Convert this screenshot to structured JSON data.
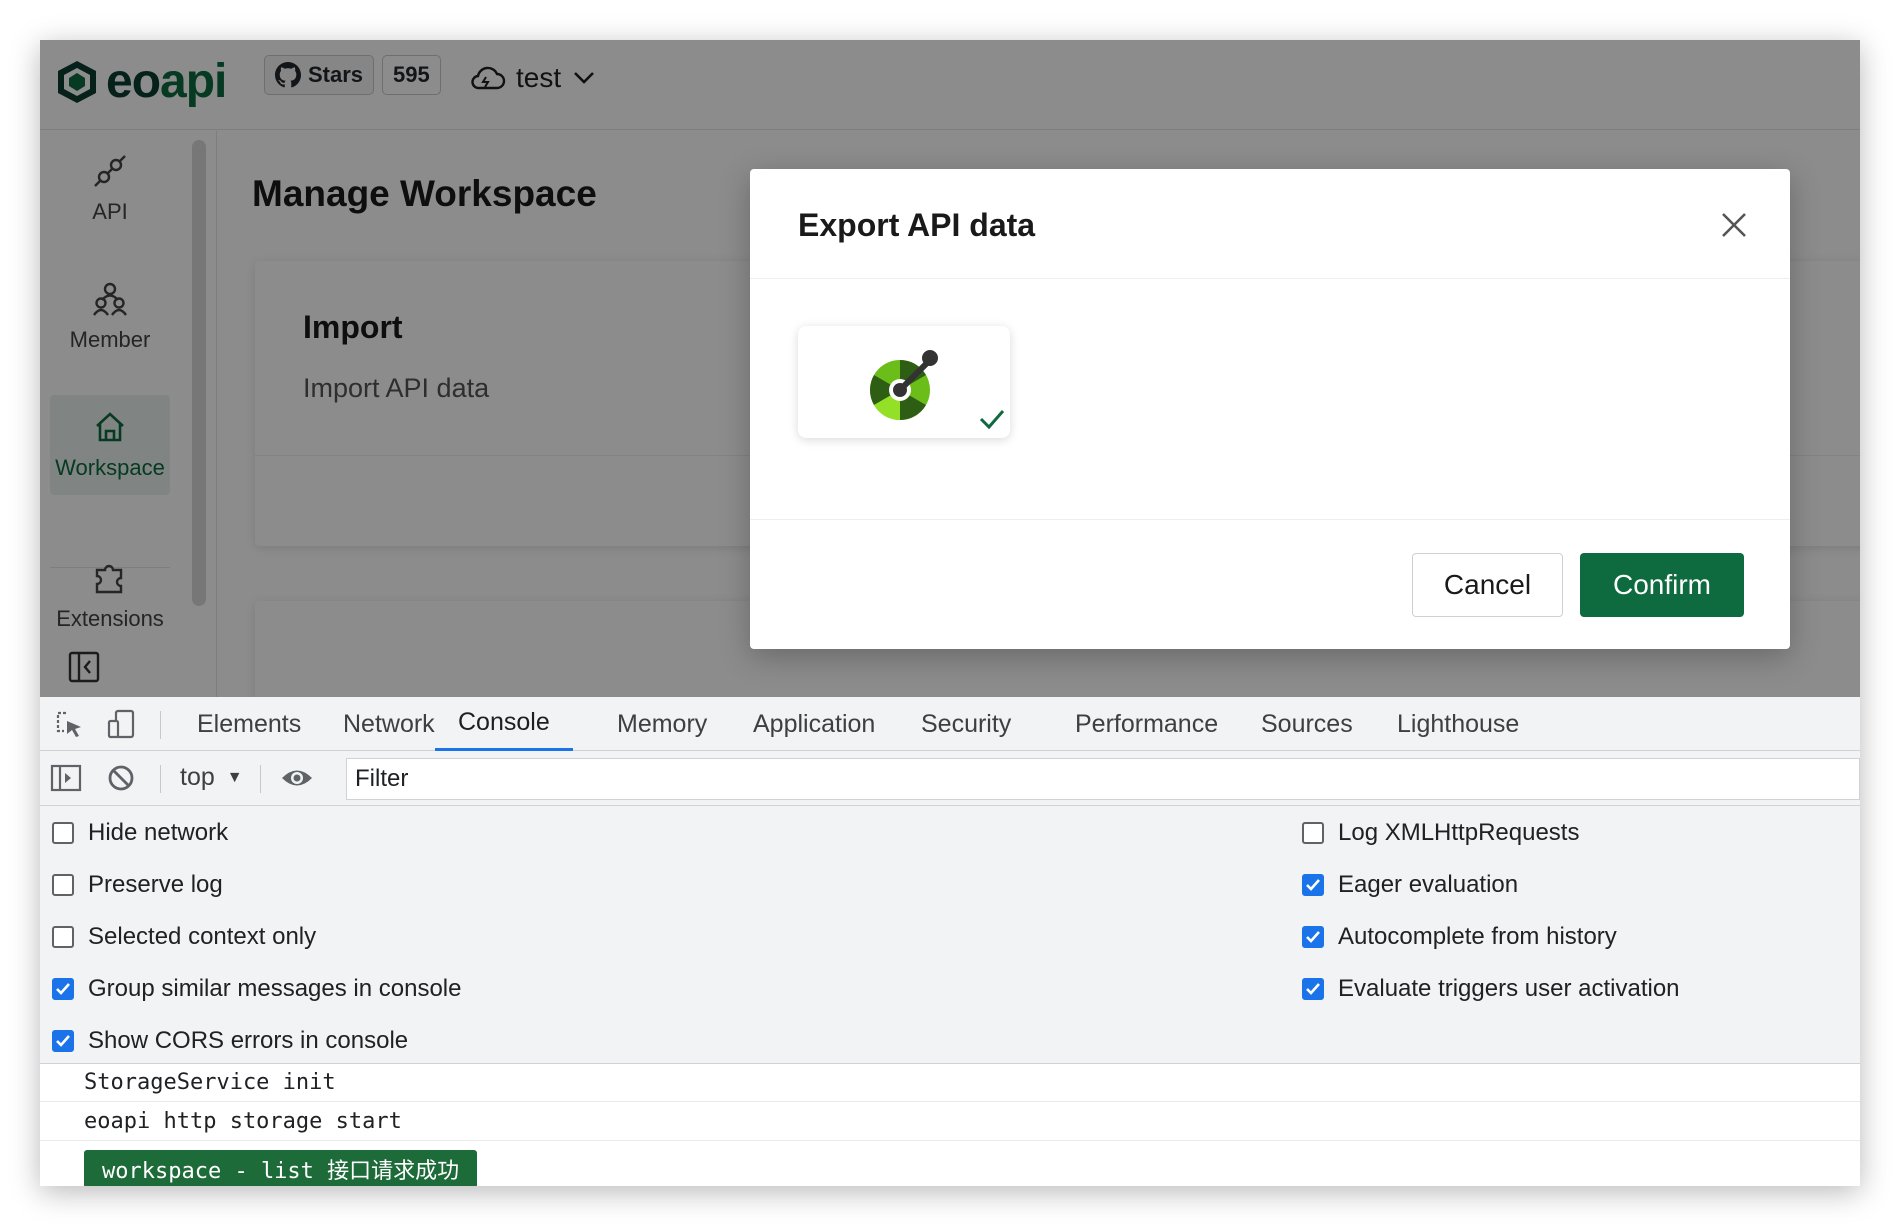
{
  "app": {
    "logo": {
      "part1": "eo",
      "part2": "api"
    },
    "github": {
      "stars_label": "Stars",
      "stars_count": "595"
    },
    "workspace_selector": {
      "label": "test"
    },
    "sidebar": {
      "items": [
        {
          "label": "API",
          "icon": "api-plug-icon"
        },
        {
          "label": "Member",
          "icon": "members-icon"
        },
        {
          "label": "Workspace",
          "icon": "home-icon",
          "active": true
        },
        {
          "label": "Extensions",
          "icon": "puzzle-icon"
        }
      ]
    },
    "main": {
      "page_title": "Manage Workspace",
      "import_card": {
        "title": "Import",
        "description": "Import API data"
      }
    }
  },
  "modal": {
    "title": "Export API data",
    "option": {
      "name": "openapi",
      "selected": true
    },
    "cancel_label": "Cancel",
    "confirm_label": "Confirm"
  },
  "devtools": {
    "tabs": [
      "Elements",
      "Network",
      "Console",
      "Memory",
      "Application",
      "Security",
      "Performance",
      "Sources",
      "Lighthouse"
    ],
    "active_tab": "Console",
    "context": "top",
    "filter_placeholder": "Filter",
    "settings_left": [
      {
        "label": "Hide network",
        "checked": false
      },
      {
        "label": "Preserve log",
        "checked": false
      },
      {
        "label": "Selected context only",
        "checked": false
      },
      {
        "label": "Group similar messages in console",
        "checked": true
      },
      {
        "label": "Show CORS errors in console",
        "checked": true
      }
    ],
    "settings_right": [
      {
        "label": "Log XMLHttpRequests",
        "checked": false
      },
      {
        "label": "Eager evaluation",
        "checked": true
      },
      {
        "label": "Autocomplete from history",
        "checked": true
      },
      {
        "label": "Evaluate triggers user activation",
        "checked": true
      }
    ],
    "console_lines": [
      "StorageService init",
      "eoapi http storage start"
    ],
    "console_badge": "workspace - list 接口请求成功"
  },
  "colors": {
    "brand": "#0e6b3f",
    "brand_dark": "#0b3d2e",
    "devtools_accent": "#1a73e8",
    "log_badge_bg": "#1e6b3a"
  }
}
